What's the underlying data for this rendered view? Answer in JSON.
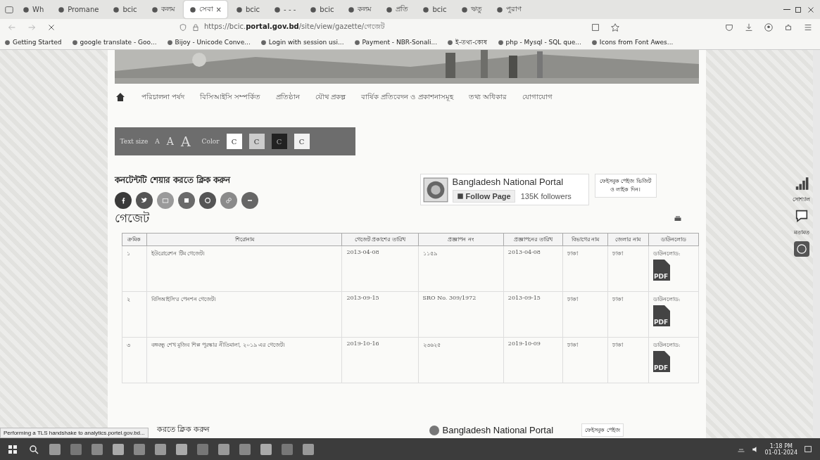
{
  "browser": {
    "tabs": [
      {
        "label": "Wh",
        "selected": false
      },
      {
        "label": "Promane",
        "selected": false
      },
      {
        "label": "bcic",
        "selected": false
      },
      {
        "label": "কলম",
        "selected": false
      },
      {
        "label": "সেবা",
        "selected": true,
        "close": "×"
      },
      {
        "label": "bcic",
        "selected": false
      },
      {
        "label": "- - -",
        "selected": false
      },
      {
        "label": "bcic",
        "selected": false
      },
      {
        "label": "কলম",
        "selected": false
      },
      {
        "label": "প্রতি",
        "selected": false
      },
      {
        "label": "bcic",
        "selected": false
      },
      {
        "label": "ঋতু",
        "selected": false
      },
      {
        "label": "পুরাণ",
        "selected": false
      }
    ],
    "url_host": "https://bcic.",
    "url_domain": "portal.gov.bd",
    "url_path": "/site/view/gazette/গেজেট",
    "bookmarks": [
      "Getting Started",
      "google translate - Goo...",
      "Bijoy - Unicode Conve...",
      "Login with session usi...",
      "Payment - NBR-Sonali...",
      "ই-তথ্য-কোষ",
      "php - Mysql - SQL que...",
      "Icons from Font Awes..."
    ]
  },
  "nav": [
    "পরিচালনা পর্ষদ",
    "বিসিআইসি সম্পর্কিত",
    "প্রতিষ্ঠান",
    "যৌথ প্রকল্প",
    "বার্ষিক প্রতিবেদন ও প্রকাশনাসমূহ",
    "তথ্য অধিকার",
    "যোগাযোগ"
  ],
  "accessibility": {
    "size_label": "Text size",
    "sizes": [
      "A",
      "A",
      "A"
    ],
    "color_label": "Color",
    "swatches": [
      {
        "label": "C",
        "color": "#ffffff"
      },
      {
        "label": "C",
        "color": "#cccccc"
      },
      {
        "label": "C",
        "color": "#222222"
      },
      {
        "label": "C",
        "color": "#f2f2f2"
      }
    ]
  },
  "share": {
    "heading": "কনটেন্টটি শেয়ার করতে ক্লিক করুন",
    "buttons": [
      {
        "kind": "facebook",
        "color": "#3a3a3a"
      },
      {
        "kind": "twitter",
        "color": "#555555"
      },
      {
        "kind": "email",
        "color": "#9a9a9a"
      },
      {
        "kind": "linkedin",
        "color": "#6a6a6a"
      },
      {
        "kind": "at",
        "color": "#555555"
      },
      {
        "kind": "link",
        "color": "#8a8a8a"
      },
      {
        "kind": "more",
        "color": "#666666"
      }
    ]
  },
  "facebook_widget": {
    "title": "Bangladesh National Portal",
    "follow": "Follow Page",
    "followers": "135K followers",
    "note": "ফেইসবুক পেইজ ভিজিট ও লাইক দিন।"
  },
  "gazette": {
    "heading": "গেজেট",
    "columns": [
      "ক্রমিক",
      "শিরোনাম",
      "গেজেট প্রকাশের তারিখ",
      "প্রজ্ঞাপন নং",
      "প্রজ্ঞাপনের তারিখ",
      "বিভাগের নাম",
      "জেলার নাম",
      "ডাউনলোড"
    ],
    "rows": [
      {
        "cells": [
          "১",
          "ইউরোরেশন টিম গেজেট।",
          "2013-04-08",
          "১১৫৯",
          "2013-04-08",
          "ঢাকা",
          "ঢাকা",
          "ডাউনলোড:"
        ],
        "pdf_label": "PDF"
      },
      {
        "cells": [
          "২",
          "বিসিআইসি'র পেনশন গেজেট।",
          "2013-09-15",
          "SRO No. 309/1972",
          "2013-09-15",
          "ঢাকা",
          "ঢাকা",
          "ডাউনলোড:"
        ],
        "pdf_label": "PDF"
      },
      {
        "cells": [
          "৩",
          "বঙ্গবন্ধু শেখ মুজিব শিল্প পুরস্কার নীতিমালা, ২০১৯ এর গেজেট।",
          "2019-10-16",
          "২৩৬২৫",
          "2019-10-09",
          "ঢাকা",
          "ঢাকা",
          "ডাউনলোড:"
        ],
        "pdf_label": "PDF"
      }
    ]
  },
  "side_float": [
    "সোশ্যাল",
    "মতামত"
  ],
  "repeat": {
    "share_tail": "করতে ক্লিক করুন",
    "title": "Bangladesh National Portal",
    "note": "ফেইসবুক পেইজ"
  },
  "status": "Performing a TLS handshake to analytics.portel.gov.bd...",
  "taskbar": {
    "time": "1:18 PM",
    "date": "01-01-2024"
  }
}
